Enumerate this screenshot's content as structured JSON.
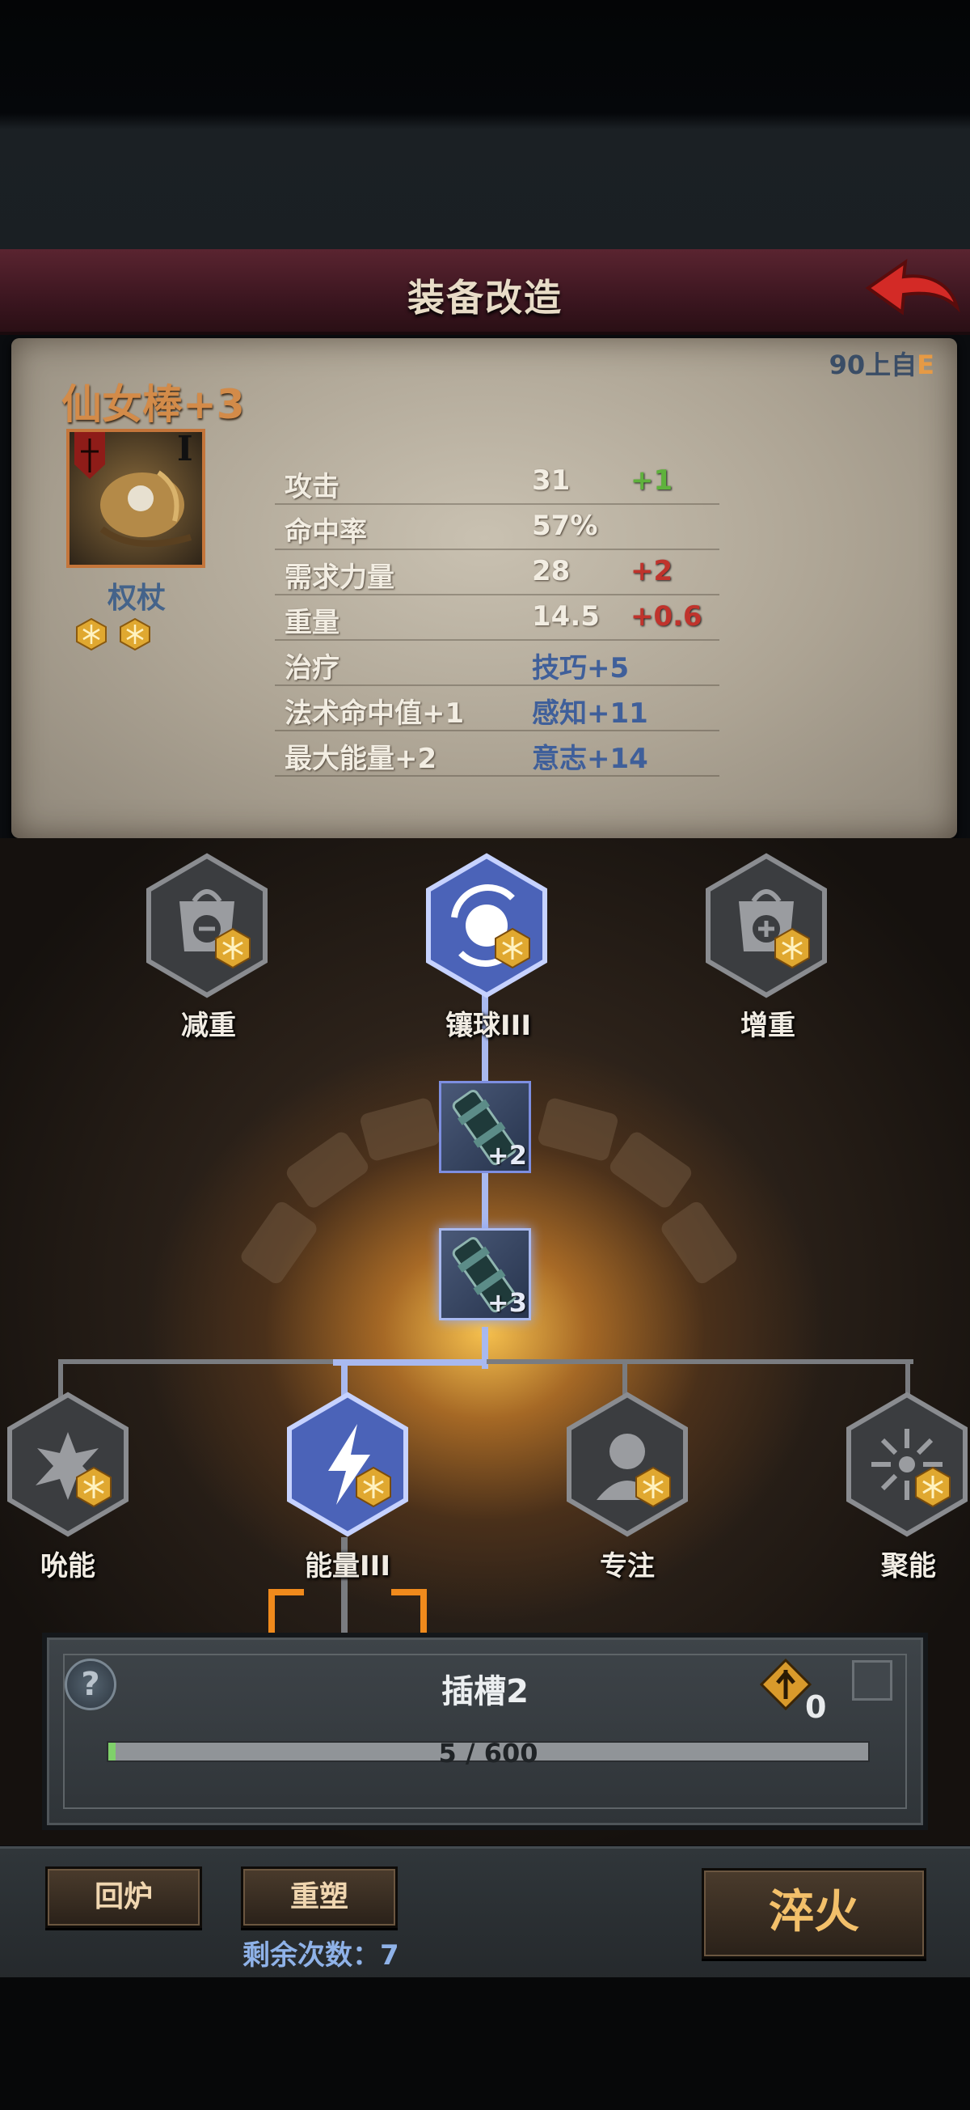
{
  "header": {
    "title": "装备改造",
    "back_icon": "red-curved-arrow-icon"
  },
  "item": {
    "name": "仙女棒+3",
    "rank": "I",
    "type": "权杖",
    "gem_count": 2,
    "source_prefix": "90上自",
    "grade": "E",
    "stats": [
      {
        "name": "攻击",
        "value": "31",
        "delta": "+1",
        "delta_color": "#5fb23c"
      },
      {
        "name": "命中率",
        "value": "57%",
        "delta": "",
        "delta_color": ""
      },
      {
        "name": "需求力量",
        "value": "28",
        "delta": "+2",
        "delta_color": "#c0332c"
      },
      {
        "name": "重量",
        "value": "14.5",
        "delta": "+0.6",
        "delta_color": "#c0332c"
      },
      {
        "name": "治疗",
        "value": "技巧+5",
        "delta": "",
        "delta_color": ""
      },
      {
        "name": "法术命中值+1",
        "value": "感知+11",
        "delta": "",
        "delta_color": ""
      },
      {
        "name": "最大能量+2",
        "value": "意志+14",
        "delta": "",
        "delta_color": ""
      }
    ]
  },
  "tree": {
    "top_nodes": [
      {
        "label": "减重",
        "icon": "weight-minus-icon",
        "active": false
      },
      {
        "label": "镶球III",
        "icon": "orb-swirl-icon",
        "active": true
      },
      {
        "label": "增重",
        "icon": "weight-plus-icon",
        "active": false
      }
    ],
    "parts": [
      {
        "level": "+2"
      },
      {
        "level": "+3"
      }
    ],
    "bottom_nodes": [
      {
        "label": "吮能",
        "icon": "burst-icon",
        "active": false
      },
      {
        "label": "能量III",
        "icon": "lightning-icon",
        "active": true
      },
      {
        "label": "专注",
        "icon": "head-silhouette-icon",
        "active": false
      },
      {
        "label": "聚能",
        "icon": "radial-burst-icon",
        "active": false
      }
    ]
  },
  "slot": {
    "title": "插槽2",
    "token_count": "0",
    "progress_text": "5 / 600",
    "progress_value": 5,
    "progress_max": 600,
    "help_glyph": "?"
  },
  "actions": {
    "recycle_label": "回炉",
    "reforge_label": "重塑",
    "remaining_label": "剩余次数：7",
    "temper_label": "淬火"
  }
}
